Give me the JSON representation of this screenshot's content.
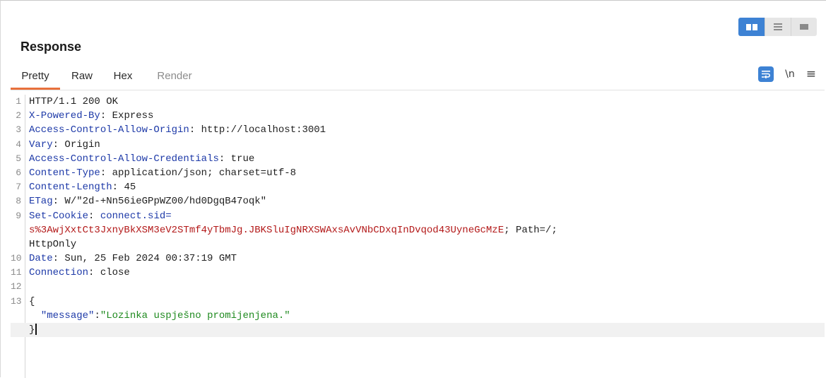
{
  "panel": {
    "title": "Response",
    "tabs": [
      "Pretty",
      "Raw",
      "Hex",
      "Render"
    ],
    "active_tab": "Pretty",
    "tools": {
      "newline_label": "\\n",
      "menu_glyph": "≡"
    },
    "layout_toggle": [
      "split-view-icon",
      "rows-view-icon",
      "single-view-icon"
    ]
  },
  "response": {
    "lines": [
      {
        "n": "1",
        "plain": "HTTP/1.1 200 OK"
      },
      {
        "n": "2",
        "key": "X-Powered-By",
        "sep": ": ",
        "val": "Express"
      },
      {
        "n": "3",
        "key": "Access-Control-Allow-Origin",
        "sep": ": ",
        "val": "http://localhost:3001"
      },
      {
        "n": "4",
        "key": "Vary",
        "sep": ": ",
        "val": "Origin"
      },
      {
        "n": "5",
        "key": "Access-Control-Allow-Credentials",
        "sep": ": ",
        "val": "true"
      },
      {
        "n": "6",
        "key": "Content-Type",
        "sep": ": ",
        "val": "application/json; charset=utf-8"
      },
      {
        "n": "7",
        "key": "Content-Length",
        "sep": ": ",
        "val": "45"
      },
      {
        "n": "8",
        "key": "ETag",
        "sep": ": ",
        "val": "W/\"2d-+Nn56ieGPpWZ00/hd0DgqB47oqk\""
      },
      {
        "n": "9",
        "key": "Set-Cookie",
        "sep": ": ",
        "cookie_name": "connect.sid="
      },
      {
        "n": "",
        "cookie_value": "s%3AwjXxtCt3JxnyBkXSM3eV2STmf4yTbmJg.JBKSluIgNRXSWAxsAvVNbCDxqInDvqod43UyneGcMzE",
        "rest": "; Path=/;"
      },
      {
        "n": "",
        "plain": "HttpOnly"
      },
      {
        "n": "10",
        "key": "Date",
        "sep": ": ",
        "val": "Sun, 25 Feb 2024 00:37:19 GMT"
      },
      {
        "n": "11",
        "key": "Connection",
        "sep": ": ",
        "val": "close"
      },
      {
        "n": "12",
        "plain": ""
      },
      {
        "n": "13",
        "plain": "{"
      },
      {
        "n": "",
        "json_key": "\"message\"",
        "json_sep": ":",
        "json_val": "\"Lozinka uspješno promijenjena.\"",
        "indent": "  "
      },
      {
        "n": "",
        "plain": "}",
        "cursor": true
      }
    ]
  },
  "colors": {
    "accent": "#e8703c",
    "blue_button": "#3d82d4",
    "header_key": "#1e3aa8",
    "cookie_value": "#b31919",
    "json_string": "#1f8a1f"
  }
}
